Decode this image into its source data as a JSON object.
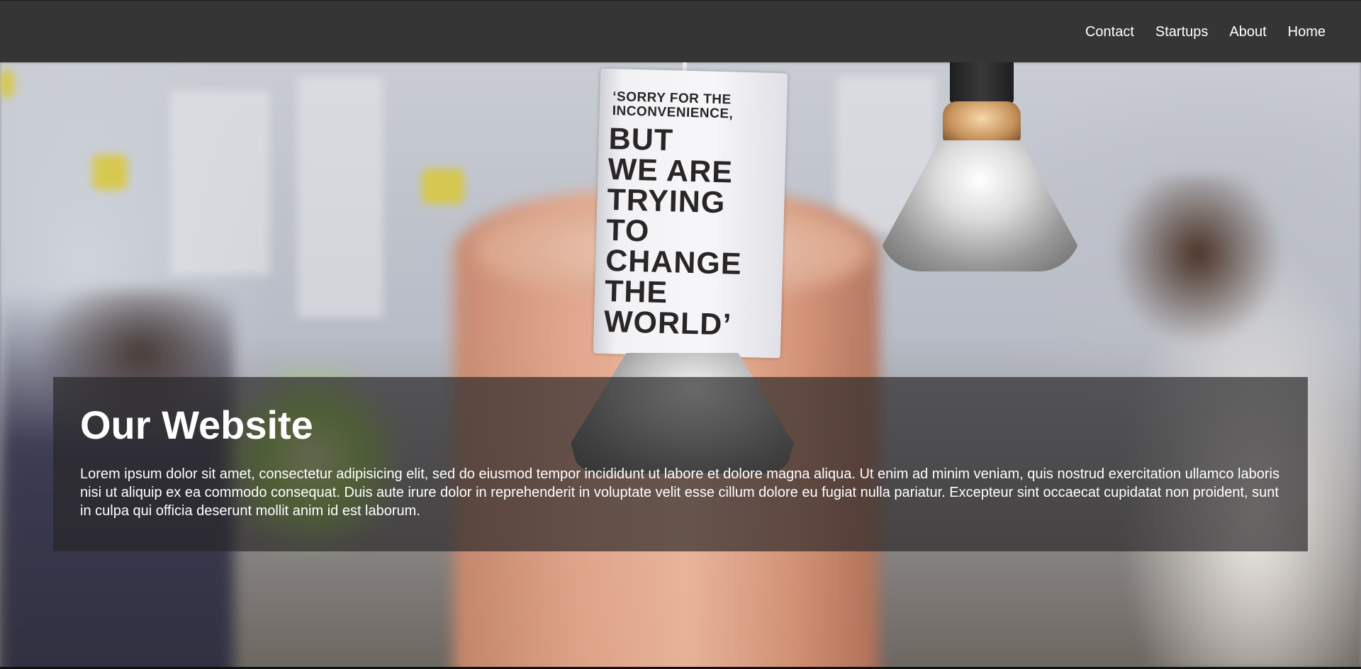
{
  "nav": {
    "items": [
      {
        "label": "Contact"
      },
      {
        "label": "Startups"
      },
      {
        "label": "About"
      },
      {
        "label": "Home"
      }
    ]
  },
  "hero": {
    "sign_small_text": "‘SORRY FOR THE\nINCONVENIENCE,",
    "sign_big_text": "BUT\nWE ARE\nTRYING\nTO\nCHANGE\nTHE\nWORLD’"
  },
  "caption": {
    "title": "Our Website",
    "body": "Lorem ipsum dolor sit amet, consectetur adipisicing elit, sed do eiusmod tempor incididunt ut labore et dolore magna aliqua. Ut enim ad minim veniam, quis nostrud exercitation ullamco laboris nisi ut aliquip ex ea commodo consequat. Duis aute irure dolor in reprehenderit in voluptate velit esse cillum dolore eu fugiat nulla pariatur. Excepteur sint occaecat cupidatat non proident, sunt in culpa qui officia deserunt mollit anim id est laborum."
  },
  "colors": {
    "topbar": "#353535",
    "caption_bg": "rgba(40,38,40,0.68)",
    "text": "#ffffff"
  }
}
